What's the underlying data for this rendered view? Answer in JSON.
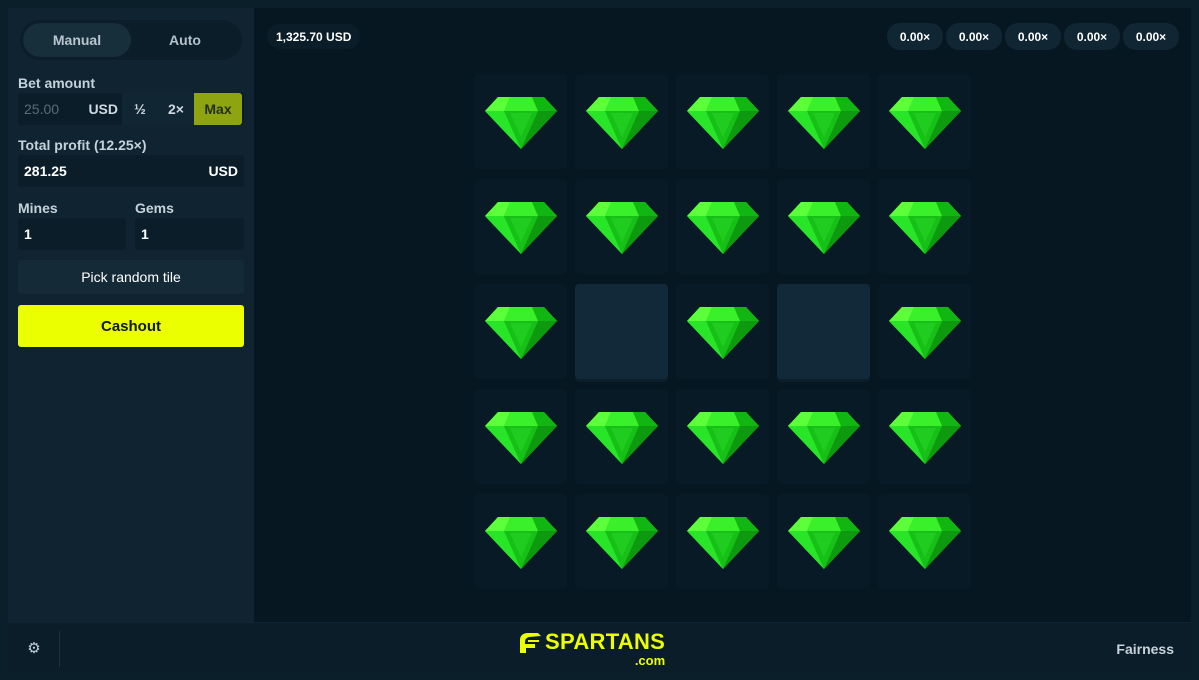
{
  "sidebar": {
    "tabs": [
      {
        "label": "Manual",
        "active": true
      },
      {
        "label": "Auto",
        "active": false
      }
    ],
    "bet": {
      "label": "Bet amount",
      "placeholder": "25.00",
      "currency": "USD",
      "half_label": "½",
      "double_label": "2×",
      "max_label": "Max"
    },
    "profit": {
      "label": "Total profit (12.25×)",
      "value": "281.25",
      "currency": "USD"
    },
    "mines": {
      "label": "Mines",
      "value": "1"
    },
    "gems": {
      "label": "Gems",
      "value": "1"
    },
    "pick_random_label": "Pick random tile",
    "cashout_label": "Cashout"
  },
  "topbar": {
    "balance": "1,325.70 USD",
    "multipliers": [
      "0.00×",
      "0.00×",
      "0.00×",
      "0.00×",
      "0.00×"
    ]
  },
  "board": {
    "rows": 5,
    "cols": 5,
    "tiles": [
      "gem",
      "gem",
      "gem",
      "gem",
      "gem",
      "gem",
      "gem",
      "gem",
      "gem",
      "gem",
      "gem",
      "hidden",
      "gem",
      "hidden",
      "gem",
      "gem",
      "gem",
      "gem",
      "gem",
      "gem",
      "gem",
      "gem",
      "gem",
      "gem",
      "gem"
    ],
    "gem_icon": "emerald-gem-icon",
    "gem_color": "#22e622"
  },
  "footer": {
    "settings_icon": "gear-icon",
    "logo_name": "SPARTANS",
    "logo_sub": ".com",
    "fairness_label": "Fairness"
  },
  "colors": {
    "accent": "#ecff00",
    "max_button": "#8ea511",
    "background": "#061722",
    "panel": "#0f2430"
  }
}
